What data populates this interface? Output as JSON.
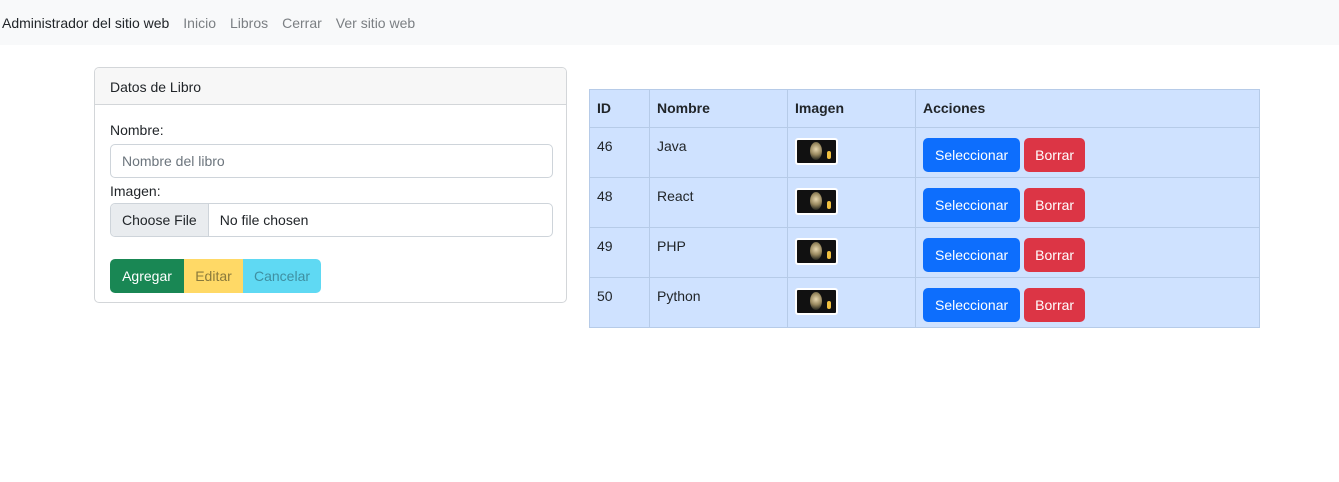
{
  "navbar": {
    "brand": "Administrador del sitio web",
    "links": [
      "Inicio",
      "Libros",
      "Cerrar",
      "Ver sitio web"
    ]
  },
  "form": {
    "header": "Datos de Libro",
    "nombre_label": "Nombre:",
    "nombre_placeholder": "Nombre del libro",
    "nombre_value": "",
    "imagen_label": "Imagen:",
    "file_button": "Choose File",
    "file_status": "No file chosen",
    "buttons": {
      "agregar": "Agregar",
      "editar": "Editar",
      "cancelar": "Cancelar"
    }
  },
  "table": {
    "headers": [
      "ID",
      "Nombre",
      "Imagen",
      "Acciones"
    ],
    "rows": [
      {
        "id": "46",
        "nombre": "Java"
      },
      {
        "id": "48",
        "nombre": "React"
      },
      {
        "id": "49",
        "nombre": "PHP"
      },
      {
        "id": "50",
        "nombre": "Python"
      }
    ],
    "select_label": "Seleccionar",
    "delete_label": "Borrar"
  },
  "colors": {
    "navbar_bg": "#f8f9fa",
    "success": "#198754",
    "warning": "#ffd966",
    "info": "#5fd9f3",
    "primary": "#0d6efd",
    "danger": "#dc3545",
    "table_bg": "#cfe2ff"
  }
}
